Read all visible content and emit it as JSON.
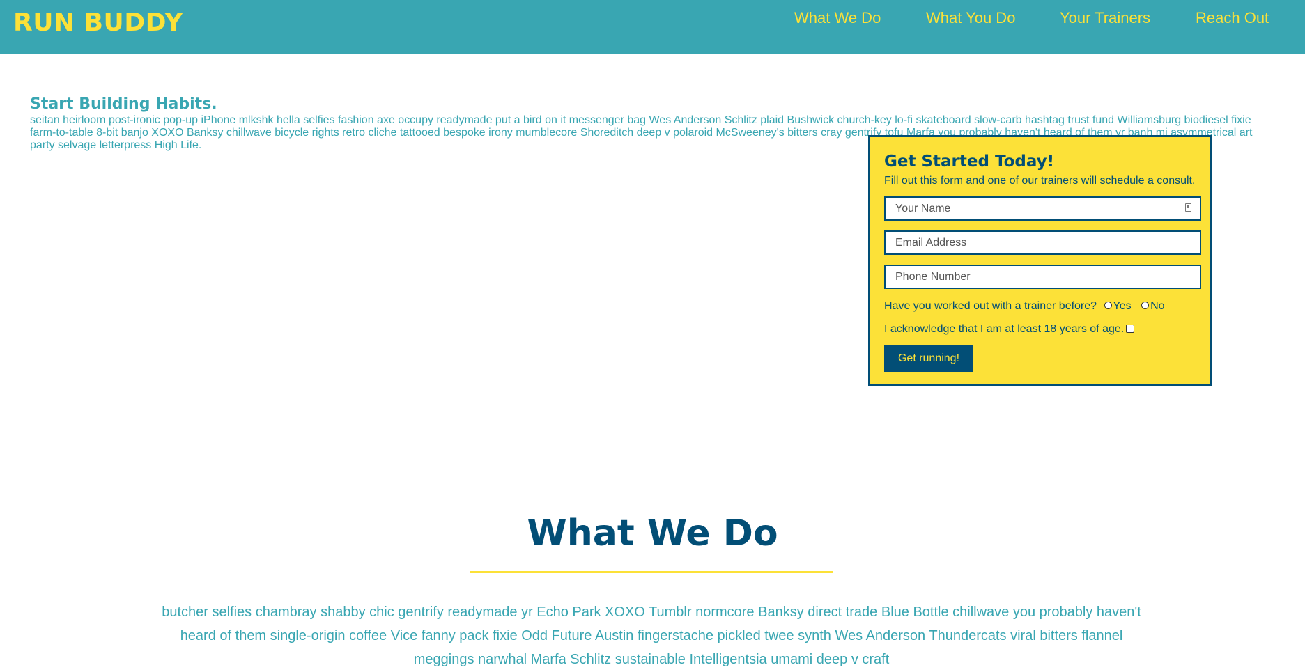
{
  "header": {
    "logo": "RUN BUDDY",
    "nav": [
      "What We Do",
      "What You Do",
      "Your Trainers",
      "Reach Out"
    ]
  },
  "hero": {
    "title": "Start Building Habits.",
    "text": "seitan heirloom post-ironic pop-up iPhone mlkshk hella selfies fashion axe occupy readymade put a bird on it messenger bag Wes Anderson Schlitz plaid Bushwick church-key lo-fi skateboard slow-carb hashtag trust fund Williamsburg biodiesel fixie farm-to-table 8-bit banjo XOXO Banksy chillwave bicycle rights retro cliche tattooed bespoke irony mumblecore Shoreditch deep v polaroid McSweeney's bitters cray gentrify tofu Marfa you probably haven't heard of them yr banh mi asymmetrical art party selvage letterpress High Life."
  },
  "form": {
    "title": "Get Started Today!",
    "subtitle": "Fill out this form and one of our trainers will schedule a consult.",
    "name_placeholder": "Your Name",
    "email_placeholder": "Email Address",
    "phone_placeholder": "Phone Number",
    "trainer_question": "Have you worked out with a trainer before?",
    "yes_label": "Yes",
    "no_label": "No",
    "age_ack": "I acknowledge that I am at least 18 years of age.",
    "submit_label": "Get running!",
    "icons": {
      "name_field": "contact-card-icon"
    }
  },
  "what_we_do": {
    "title": "What We Do",
    "text": "butcher selfies chambray shabby chic gentrify readymade yr Echo Park XOXO Tumblr normcore Banksy direct trade Blue Bottle chillwave you probably haven't heard of them single-origin coffee Vice fanny pack fixie Odd Future Austin fingerstache pickled twee synth Wes Anderson Thundercats viral bitters flannel meggings narwhal Marfa Schlitz sustainable Intelligentsia umami deep v craft"
  },
  "colors": {
    "primary": "#39a6b2",
    "accent": "#fce138",
    "dark": "#024e76"
  }
}
